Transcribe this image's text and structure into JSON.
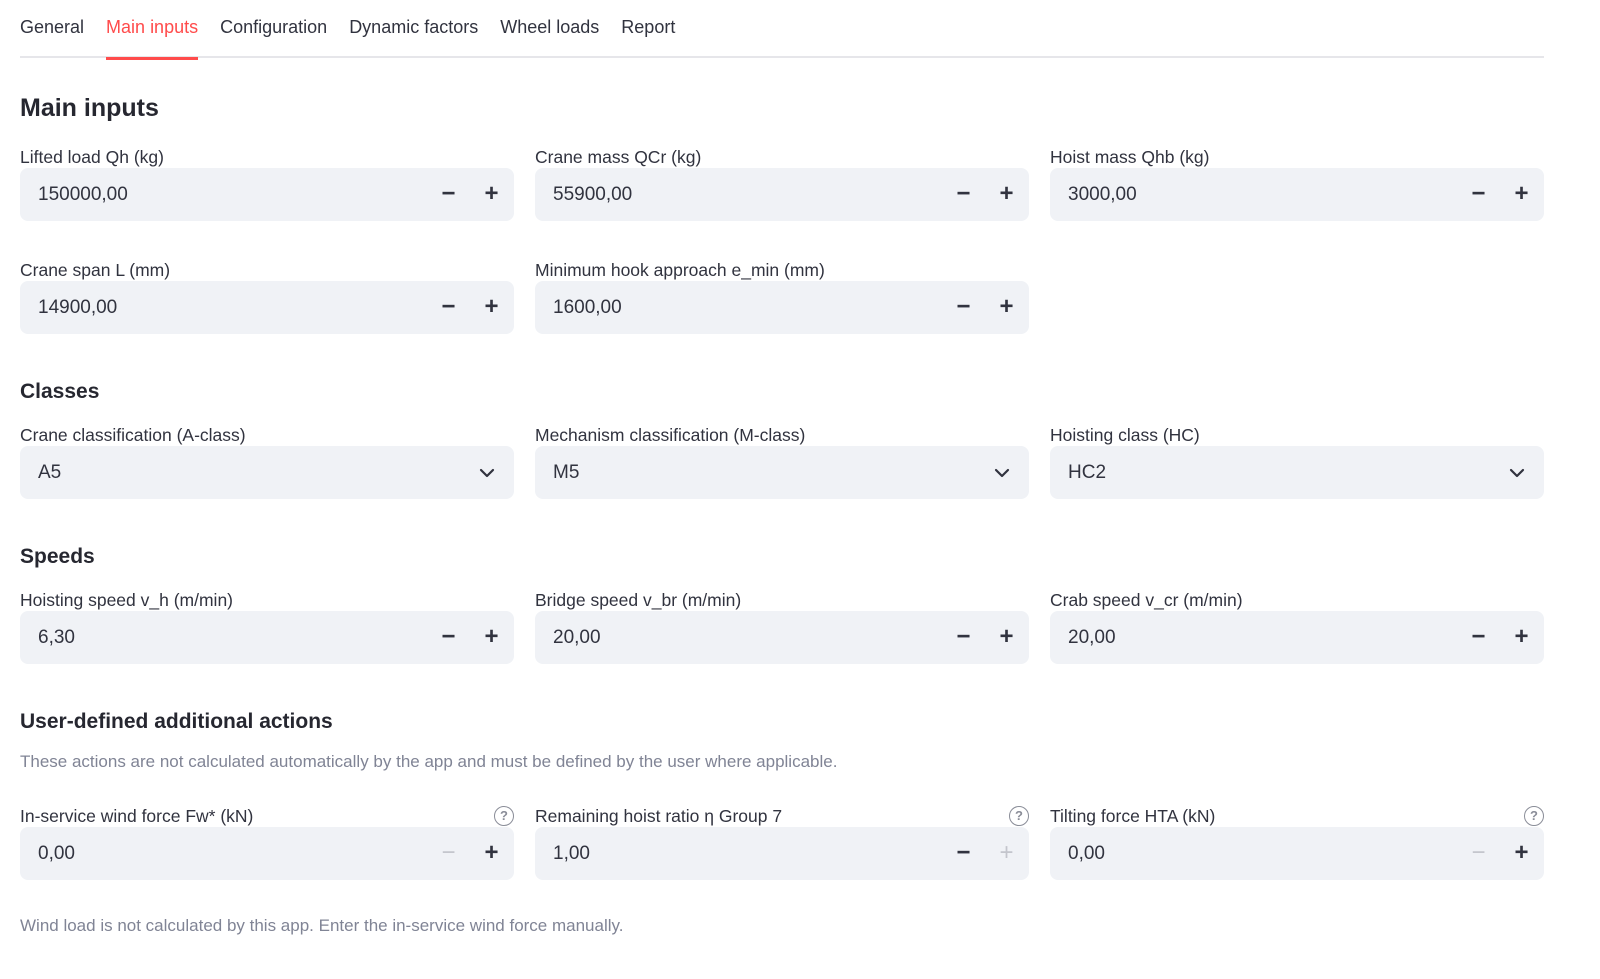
{
  "tabs": [
    "General",
    "Main inputs",
    "Configuration",
    "Dynamic factors",
    "Wheel loads",
    "Report"
  ],
  "active_tab": "Main inputs",
  "title": "Main inputs",
  "main": {
    "lifted_load": {
      "label": "Lifted load Qh (kg)",
      "value": "150000,00"
    },
    "crane_mass": {
      "label": "Crane mass QCr (kg)",
      "value": "55900,00"
    },
    "hoist_mass": {
      "label": "Hoist mass Qhb (kg)",
      "value": "3000,00"
    },
    "crane_span": {
      "label": "Crane span L (mm)",
      "value": "14900,00"
    },
    "hook_approach": {
      "label": "Minimum hook approach e_min (mm)",
      "value": "1600,00"
    }
  },
  "classes": {
    "heading": "Classes",
    "crane_class": {
      "label": "Crane classification (A-class)",
      "value": "A5"
    },
    "mechanism_class": {
      "label": "Mechanism classification (M-class)",
      "value": "M5"
    },
    "hoisting_class": {
      "label": "Hoisting class (HC)",
      "value": "HC2"
    }
  },
  "speeds": {
    "heading": "Speeds",
    "hoisting": {
      "label": "Hoisting speed v_h (m/min)",
      "value": "6,30"
    },
    "bridge": {
      "label": "Bridge speed v_br (m/min)",
      "value": "20,00"
    },
    "crab": {
      "label": "Crab speed v_cr (m/min)",
      "value": "20,00"
    }
  },
  "actions": {
    "heading": "User-defined additional actions",
    "caption": "These actions are not calculated automatically by the app and must be defined by the user where applicable.",
    "wind": {
      "label": "In-service wind force Fw* (kN)",
      "value": "0,00"
    },
    "hoist_ratio": {
      "label": "Remaining hoist ratio η Group 7",
      "value": "1,00"
    },
    "tilting": {
      "label": "Tilting force HTA (kN)",
      "value": "0,00"
    },
    "footer": "Wind load is not calculated by this app. Enter the in-service wind force manually."
  },
  "glyphs": {
    "minus": "−",
    "plus": "+",
    "help": "?"
  },
  "colors": {
    "accent": "#ff4b4b",
    "input_bg": "#f0f2f6",
    "text": "#31333f",
    "muted": "#808495"
  }
}
